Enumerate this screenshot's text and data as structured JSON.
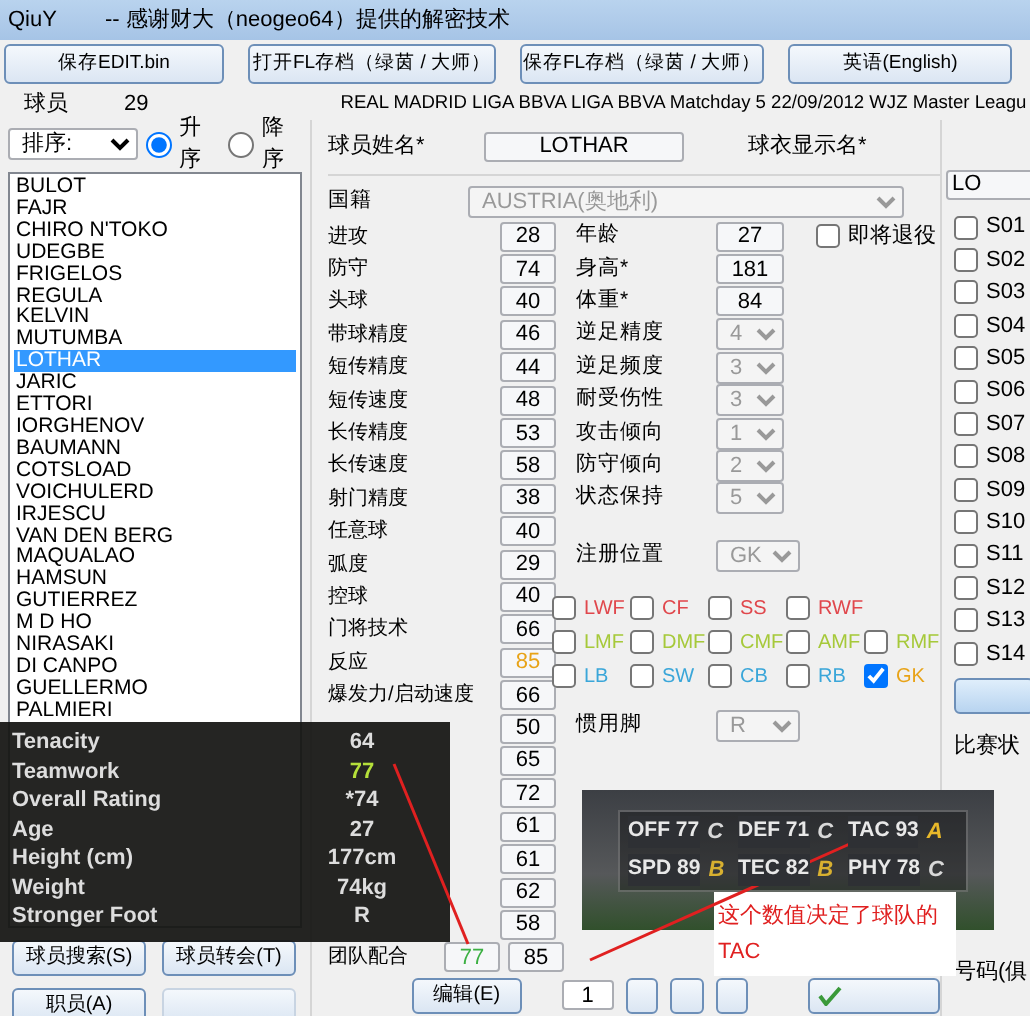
{
  "window": {
    "title": "QiuY",
    "subtitle": "-- 感谢财大（neogeo64）提供的解密技术"
  },
  "toolbar": [
    "保存EDIT.bin",
    "打开FL存档（绿茵 / 大师）",
    "保存FL存档（绿茵 / 大师）",
    "英语(English)"
  ],
  "player_count": {
    "label": "球员",
    "value": "29"
  },
  "save_info": "REAL MADRID LIGA BBVA LIGA BBVA Matchday 5  22/09/2012 WJZ Master Leagu",
  "sort": {
    "value": "排序:",
    "options": [
      {
        "label": "升序",
        "selected": true
      },
      {
        "label": "降序",
        "selected": false
      }
    ]
  },
  "players": [
    {
      "name": "BULOT",
      "selected": false
    },
    {
      "name": "FAJR",
      "selected": false
    },
    {
      "name": "CHIRO N'TOKO",
      "selected": false
    },
    {
      "name": "UDEGBE",
      "selected": false
    },
    {
      "name": "FRIGELOS",
      "selected": false
    },
    {
      "name": "REGULA",
      "selected": false
    },
    {
      "name": "KELVIN",
      "selected": false
    },
    {
      "name": "MUTUMBA",
      "selected": false
    },
    {
      "name": "LOTHAR",
      "selected": true
    },
    {
      "name": "JARIC",
      "selected": false
    },
    {
      "name": "ETTORI",
      "selected": false
    },
    {
      "name": "IORGHENOV",
      "selected": false
    },
    {
      "name": "BAUMANN",
      "selected": false
    },
    {
      "name": "COTSLOAD",
      "selected": false
    },
    {
      "name": "VOICHULERD",
      "selected": false
    },
    {
      "name": "IRJESCU",
      "selected": false
    },
    {
      "name": "VAN DEN BERG",
      "selected": false
    },
    {
      "name": "MAQUALAO",
      "selected": false
    },
    {
      "name": "HAMSUN",
      "selected": false
    },
    {
      "name": "GUTIERREZ",
      "selected": false
    },
    {
      "name": "M D HO",
      "selected": false
    },
    {
      "name": "NIRASAKI",
      "selected": false
    },
    {
      "name": "DI CANPO",
      "selected": false
    },
    {
      "name": "GUELLERMO",
      "selected": false
    },
    {
      "name": "PALMIERI",
      "selected": false
    }
  ],
  "left_buttons": [
    {
      "label": "球员搜索(S)",
      "disabled": false
    },
    {
      "label": "球员转会(T)",
      "disabled": false
    },
    {
      "label": "职员(A)",
      "disabled": false
    },
    {
      "disabled": true
    }
  ],
  "name_field": {
    "label": "球员姓名*",
    "value": "LOTHAR"
  },
  "shirt_field": {
    "label": "球衣显示名*",
    "value": "LO"
  },
  "nationality": {
    "label": "国籍",
    "value": "AUSTRIA(奥地利)"
  },
  "attributes": [
    {
      "label": "进攻",
      "value": "28"
    },
    {
      "label": "防守",
      "value": "74"
    },
    {
      "label": "头球",
      "value": "40"
    },
    {
      "label": "带球精度",
      "value": "46"
    },
    {
      "label": "短传精度",
      "value": "44"
    },
    {
      "label": "短传速度",
      "value": "48"
    },
    {
      "label": "长传精度",
      "value": "53"
    },
    {
      "label": "长传速度",
      "value": "58"
    },
    {
      "label": "射门精度",
      "value": "38"
    },
    {
      "label": "任意球",
      "value": "40"
    },
    {
      "label": "弧度",
      "value": "29"
    },
    {
      "label": "控球",
      "value": "40"
    },
    {
      "label": "门将技术",
      "value": "66"
    },
    {
      "label": "反应",
      "value": "85",
      "color": "#e8a317"
    },
    {
      "label": "爆发力/启动速度",
      "value": "66"
    },
    {
      "value": "50"
    },
    {
      "value": "65"
    },
    {
      "value": "72"
    },
    {
      "value": "61"
    },
    {
      "value": "61"
    },
    {
      "value": "62"
    },
    {
      "value": "58"
    },
    {
      "label": "团队配合",
      "value": "77",
      "color": "#3cb043"
    }
  ],
  "teamwork_extra": "85",
  "info": [
    {
      "label": "年龄",
      "value": "27"
    },
    {
      "label": "身高*",
      "value": "181"
    },
    {
      "label": "体重*",
      "value": "84"
    }
  ],
  "retiring": {
    "label": "即将退役",
    "checked": false
  },
  "ratings": [
    {
      "label": "逆足精度",
      "value": "4"
    },
    {
      "label": "逆足频度",
      "value": "3"
    },
    {
      "label": "耐受伤性",
      "value": "3"
    },
    {
      "label": "攻击倾向",
      "value": "1"
    },
    {
      "label": "防守倾向",
      "value": "2"
    },
    {
      "label": "状态保持",
      "value": "5"
    }
  ],
  "registered_position": {
    "label": "注册位置",
    "value": "GK"
  },
  "positions": [
    [
      {
        "label": "LWF",
        "color": "#e0474c",
        "checked": false
      },
      {
        "label": "CF",
        "color": "#e0474c",
        "checked": false
      },
      {
        "label": "SS",
        "color": "#e0474c",
        "checked": false
      },
      {
        "label": "RWF",
        "color": "#e0474c",
        "checked": false
      }
    ],
    [
      {
        "label": "LMF",
        "color": "#a6c93a",
        "checked": false
      },
      {
        "label": "DMF",
        "color": "#a6c93a",
        "checked": false
      },
      {
        "label": "CMF",
        "color": "#a6c93a",
        "checked": false
      },
      {
        "label": "AMF",
        "color": "#a6c93a",
        "checked": false
      },
      {
        "label": "RMF",
        "color": "#a6c93a",
        "checked": false
      }
    ],
    [
      {
        "label": "LB",
        "color": "#3aa6d9",
        "checked": false
      },
      {
        "label": "SW",
        "color": "#3aa6d9",
        "checked": false
      },
      {
        "label": "CB",
        "color": "#3aa6d9",
        "checked": false
      },
      {
        "label": "RB",
        "color": "#3aa6d9",
        "checked": false
      },
      {
        "label": "GK",
        "color": "#e8a317",
        "checked": true
      }
    ]
  ],
  "foot": {
    "label": "惯用脚",
    "value": "R"
  },
  "skills": [
    {
      "label": "S01",
      "checked": false
    },
    {
      "label": "S02",
      "checked": false
    },
    {
      "label": "S03",
      "checked": false
    },
    {
      "label": "S04",
      "checked": false
    },
    {
      "label": "S05",
      "checked": false
    },
    {
      "label": "S06",
      "checked": false
    },
    {
      "label": "S07",
      "checked": false
    },
    {
      "label": "S08",
      "checked": false
    },
    {
      "label": "S09",
      "checked": false
    },
    {
      "label": "S10",
      "checked": false
    },
    {
      "label": "S11",
      "checked": false
    },
    {
      "label": "S12",
      "checked": false
    },
    {
      "label": "S13",
      "checked": false
    },
    {
      "label": "S14",
      "checked": false
    }
  ],
  "side_labels": [
    "比赛状",
    "号码(俱"
  ],
  "edit_button": "编辑(E)",
  "page": "1",
  "overlay_stats": [
    {
      "label": "Tenacity",
      "value": "64"
    },
    {
      "label": "Teamwork",
      "value": "77",
      "color": "#b5e03a"
    },
    {
      "label": "Overall Rating",
      "value": "*74"
    },
    {
      "label": "Age",
      "value": "27"
    },
    {
      "label": "Height (cm)",
      "value": "177cm"
    },
    {
      "label": "Weight",
      "value": "74kg"
    },
    {
      "label": "Stronger Foot",
      "value": "R"
    }
  ],
  "game_ratings": [
    {
      "label": "OFF 77",
      "grade": "C"
    },
    {
      "label": "DEF 71",
      "grade": "C"
    },
    {
      "label": "TAC 93",
      "grade": "A"
    },
    {
      "label": "SPD 89",
      "grade": "B"
    },
    {
      "label": "TEC 82",
      "grade": "B"
    },
    {
      "label": "PHY 78",
      "grade": "C"
    }
  ],
  "annotation": [
    "这个数值决定了球队的",
    "TAC"
  ]
}
